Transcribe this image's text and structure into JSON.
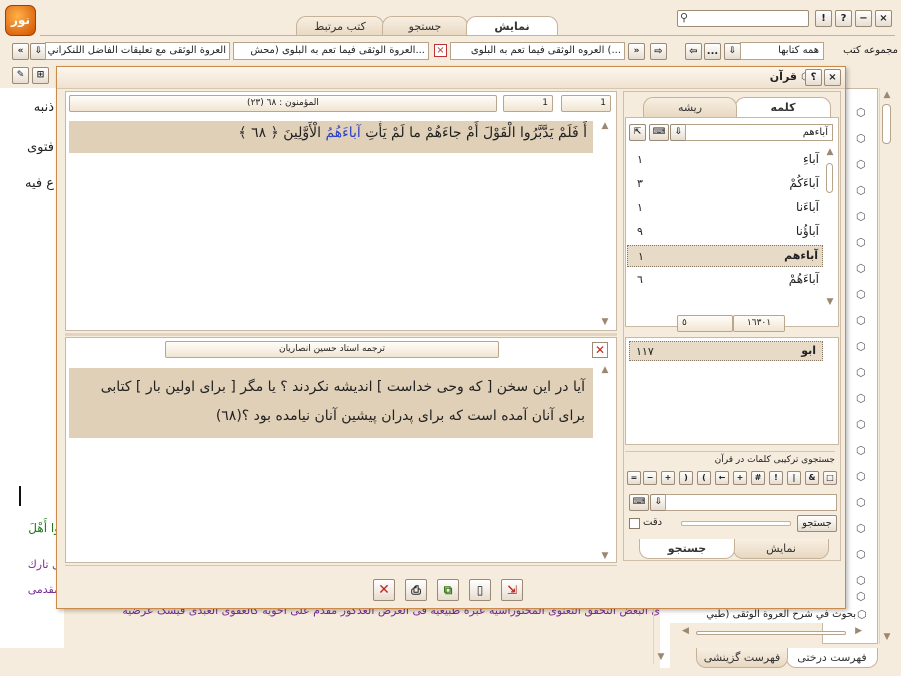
{
  "logo": "نور",
  "main_tabs": [
    {
      "label": "کتب مرتبط"
    },
    {
      "label": "جستجو"
    },
    {
      "label": "نمايش"
    }
  ],
  "tab_bar": {
    "tab1": "العروه الوثقی فيما تعم به البلوی (...",
    "tab2": "العروة الوثقی فيما تعم به البلوی (محش...",
    "tab3": "العروة الوثقی مع تعليقات الفاضل اللنكراني"
  },
  "left": {
    "group_label": "مجموعه کتب",
    "group_value": "همه کتابها",
    "more": "...",
    "tree": [
      {
        "label": "بحوث في شرح العروة الوثقى (طبي"
      }
    ],
    "bottom_tabs": [
      {
        "label": "فهرست درختی"
      },
      {
        "label": "فهرست گزينشی"
      }
    ]
  },
  "bg_text": {
    "l1": "ذنبه",
    "l2": "فتوى",
    "l3": "ع فيه",
    "g1": "وا أَهْلَ",
    "p1": "ل تارك",
    "p2": "مقدمی",
    "p3": "ی البعض التحقق التعنوی المحتوراسیه عبره طبيعیه فی الغرض العذکور مقدم علی احویه کالعفوی العبدی فيسک عرضيه"
  },
  "quran": {
    "title": "قرآن",
    "help": "؟",
    "close": "×",
    "page_a": "1",
    "page_b": "1",
    "sura_label": "(٢٣) المؤمنون : ٦٨",
    "verse_pre": "أَ فَلَمْ يَدَّبَّرُوا الْقَوْلَ أَمْ جاءَهُمْ ما لَمْ يَأْتِ ",
    "verse_hl": "آباءَهُمُ",
    "verse_post": " الْأَوَّلِينَ ﴿ ٦٨ ﴾",
    "translator": "ترجمه استاد حسين انصاريان",
    "translation": "آيا در اين سخن [ كه وحی خداست ] انديشه نكردند ؟ يا مگر [ برای اولين بار ] كتابی برای آنان آمده است كه برای پدران پيشين آنان نيامده بود ؟(٦٨)",
    "search_panel": {
      "tab_word": "كلمه",
      "tab_root": "ريشه",
      "input": "آباءهم",
      "words": [
        {
          "w": "آباءِ",
          "n": "١"
        },
        {
          "w": "آباءَكُمْ",
          "n": "٣"
        },
        {
          "w": "آباءَنا",
          "n": "١"
        },
        {
          "w": "آباؤُنا",
          "n": "٩"
        },
        {
          "w": "آباءهم",
          "n": "١"
        },
        {
          "w": "آباءَهُمْ",
          "n": "٦"
        }
      ],
      "count_a": "١٦٣٠١",
      "count_b": "٥",
      "root_word": "ابو",
      "root_count": "١١٧",
      "combo_title": "جستجوی تركيبی كلمات در قرآن",
      "ops": [
        "□",
        "&",
        "|",
        "!",
        "#",
        "+",
        "←",
        "(",
        ")",
        "+",
        "−",
        "="
      ],
      "search_btn": "جستجو",
      "precision": "دقت",
      "bottom_tabs": [
        {
          "label": "جستجو"
        },
        {
          "label": "نمايش"
        }
      ]
    }
  },
  "colors": {
    "verse_bg": "#e1d0b8",
    "verse_text": "#1a1a1a",
    "highlight": "#2a40c8",
    "selected_row": "#e7dac6",
    "accent_red": "#c0261b"
  }
}
